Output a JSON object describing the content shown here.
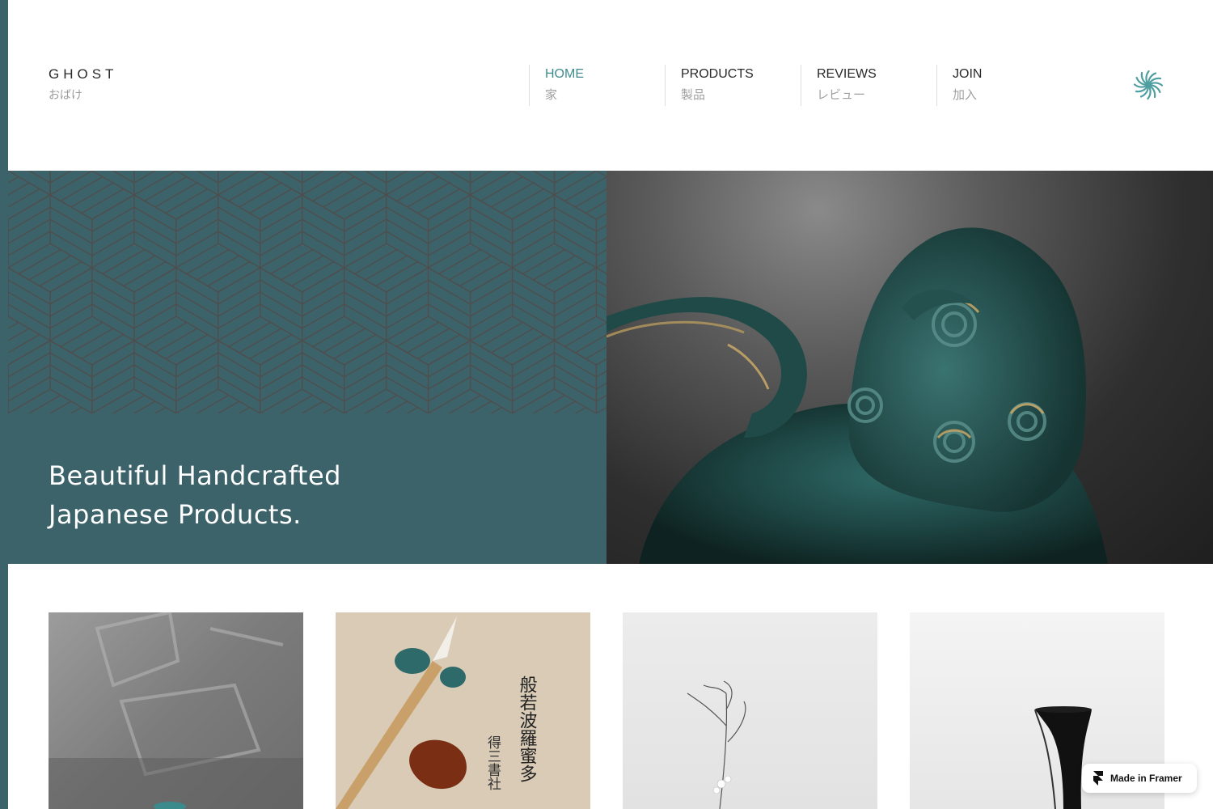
{
  "brand": {
    "name": "GHOST",
    "subtitle": "おばけ"
  },
  "nav": {
    "items": [
      {
        "label": "HOME",
        "sub": "家",
        "active": true
      },
      {
        "label": "PRODUCTS",
        "sub": "製品",
        "active": false
      },
      {
        "label": "REVIEWS",
        "sub": "レビュー",
        "active": false
      },
      {
        "label": "JOIN",
        "sub": "加入",
        "active": false
      }
    ]
  },
  "hero": {
    "title_line1": "Beautiful Handcrafted",
    "title_line2": "Japanese Products."
  },
  "products": [
    {
      "name": "product-chairs-photo"
    },
    {
      "name": "product-calligraphy-photo",
      "calligraphy_col1": "般若波羅蜜多",
      "calligraphy_col2": "得三書社"
    },
    {
      "name": "product-ikebana-photo"
    },
    {
      "name": "product-vase-photo"
    }
  ],
  "badge": {
    "label": "Made in Framer"
  },
  "colors": {
    "accent": "#3f8b8e",
    "hero_panel": "#3d636a",
    "pattern_line": "#4e4e4e"
  },
  "icons": {
    "logo": "spiral-swirl-icon",
    "framer": "framer-logo-icon"
  }
}
